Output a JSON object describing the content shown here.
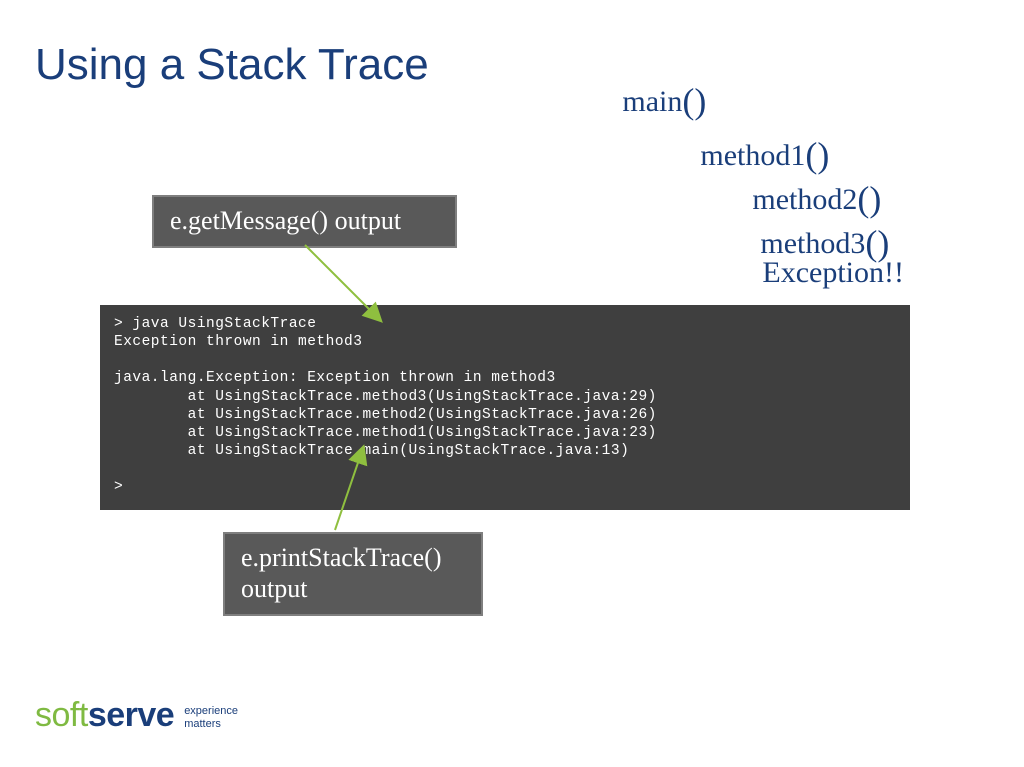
{
  "title": "Using a Stack Trace",
  "callstack": {
    "c0": "main",
    "c1": "method1",
    "c2": "method2",
    "c3": "method3",
    "parens": "()",
    "exception": "Exception!!"
  },
  "labels": {
    "top": "e.getMessage() output",
    "bottom_l1": "e.printStackTrace()",
    "bottom_l2": "output"
  },
  "console": {
    "l1": "> java UsingStackTrace",
    "l2": "Exception thrown in method3",
    "l3": "",
    "l4": "java.lang.Exception: Exception thrown in method3",
    "l5": "        at UsingStackTrace.method3(UsingStackTrace.java:29)",
    "l6": "        at UsingStackTrace.method2(UsingStackTrace.java:26)",
    "l7": "        at UsingStackTrace.method1(UsingStackTrace.java:23)",
    "l8": "        at UsingStackTrace.main(UsingStackTrace.java:13)",
    "l9": "",
    "l10": ">"
  },
  "footer": {
    "brand_soft": "soft",
    "brand_serve": "serve",
    "tag_l1": "experience",
    "tag_l2": "matters"
  }
}
